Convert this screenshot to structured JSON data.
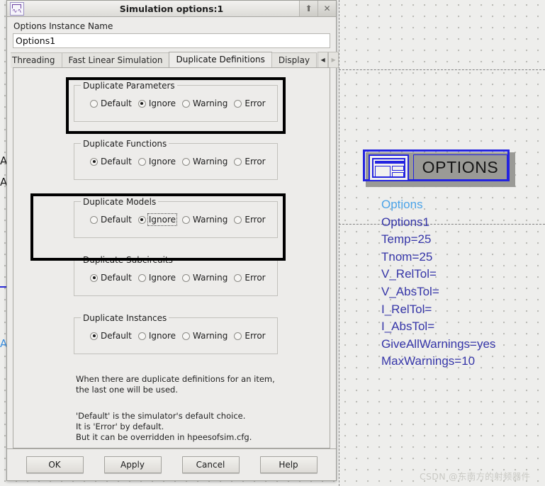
{
  "window": {
    "title": "Simulation options:1",
    "app_icon": "circuit-waveform-icon",
    "restore_glyph": "⬆",
    "close_glyph": "✕"
  },
  "form": {
    "instance_name_label": "Options Instance Name",
    "instance_name_value": "Options1"
  },
  "tabs": {
    "items": [
      {
        "label": "Threading",
        "active": false,
        "clipped": true
      },
      {
        "label": "Fast Linear Simulation",
        "active": false,
        "clipped": false
      },
      {
        "label": "Duplicate Definitions",
        "active": true,
        "clipped": false
      },
      {
        "label": "Display",
        "active": false,
        "clipped": false
      }
    ],
    "scroll_left_glyph": "◀",
    "scroll_right_glyph": "▶"
  },
  "groups": [
    {
      "title": "Duplicate Parameters",
      "options": [
        "Default",
        "Ignore",
        "Warning",
        "Error"
      ],
      "selected": "Ignore",
      "focused": false
    },
    {
      "title": "Duplicate Functions",
      "options": [
        "Default",
        "Ignore",
        "Warning",
        "Error"
      ],
      "selected": "Default",
      "focused": false
    },
    {
      "title": "Duplicate Models",
      "options": [
        "Default",
        "Ignore",
        "Warning",
        "Error"
      ],
      "selected": "Ignore",
      "focused": true
    },
    {
      "title": "Duplicate Subcircuits",
      "options": [
        "Default",
        "Ignore",
        "Warning",
        "Error"
      ],
      "selected": "Default",
      "focused": false
    },
    {
      "title": "Duplicate Instances",
      "options": [
        "Default",
        "Ignore",
        "Warning",
        "Error"
      ],
      "selected": "Default",
      "focused": false
    }
  ],
  "help": {
    "paragraph1": "When there are duplicate definitions for an item,\nthe last one will be used.",
    "paragraph2": "'Default' is the simulator's default choice.\nIt is 'Error' by default.\nBut it can be overridden in hpeesofsim.cfg."
  },
  "buttons": [
    {
      "label": "OK"
    },
    {
      "label": "Apply"
    },
    {
      "label": "Cancel"
    },
    {
      "label": "Help"
    }
  ],
  "schematic": {
    "symbol_label": "OPTIONS",
    "symbol_icon": "options-block-icon",
    "params": [
      {
        "text": "Options",
        "style": "light"
      },
      {
        "text": "Options1",
        "style": "dark"
      },
      {
        "text": "Temp=25",
        "style": "dark"
      },
      {
        "text": "Tnom=25",
        "style": "dark"
      },
      {
        "text": "V_RelTol=",
        "style": "dark"
      },
      {
        "text": "V_AbsTol=",
        "style": "dark"
      },
      {
        "text": "I_RelTol=",
        "style": "dark"
      },
      {
        "text": "I_AbsTol=",
        "style": "dark"
      },
      {
        "text": "GiveAllWarnings=yes",
        "style": "dark"
      },
      {
        "text": "MaxWarnings=10",
        "style": "dark"
      }
    ],
    "edge_glyphs": [
      "A",
      "A"
    ],
    "edge_blue_glyph": "A",
    "watermark": "CSDN @东南方的射频器件"
  },
  "colors": {
    "symbol_blue": "#2323e0",
    "param_light": "#4ba3e8",
    "param_dark": "#3535a8",
    "annotation": "#000000",
    "canvas_bg": "#eeeeec",
    "dialog_bg": "#edeceA"
  }
}
